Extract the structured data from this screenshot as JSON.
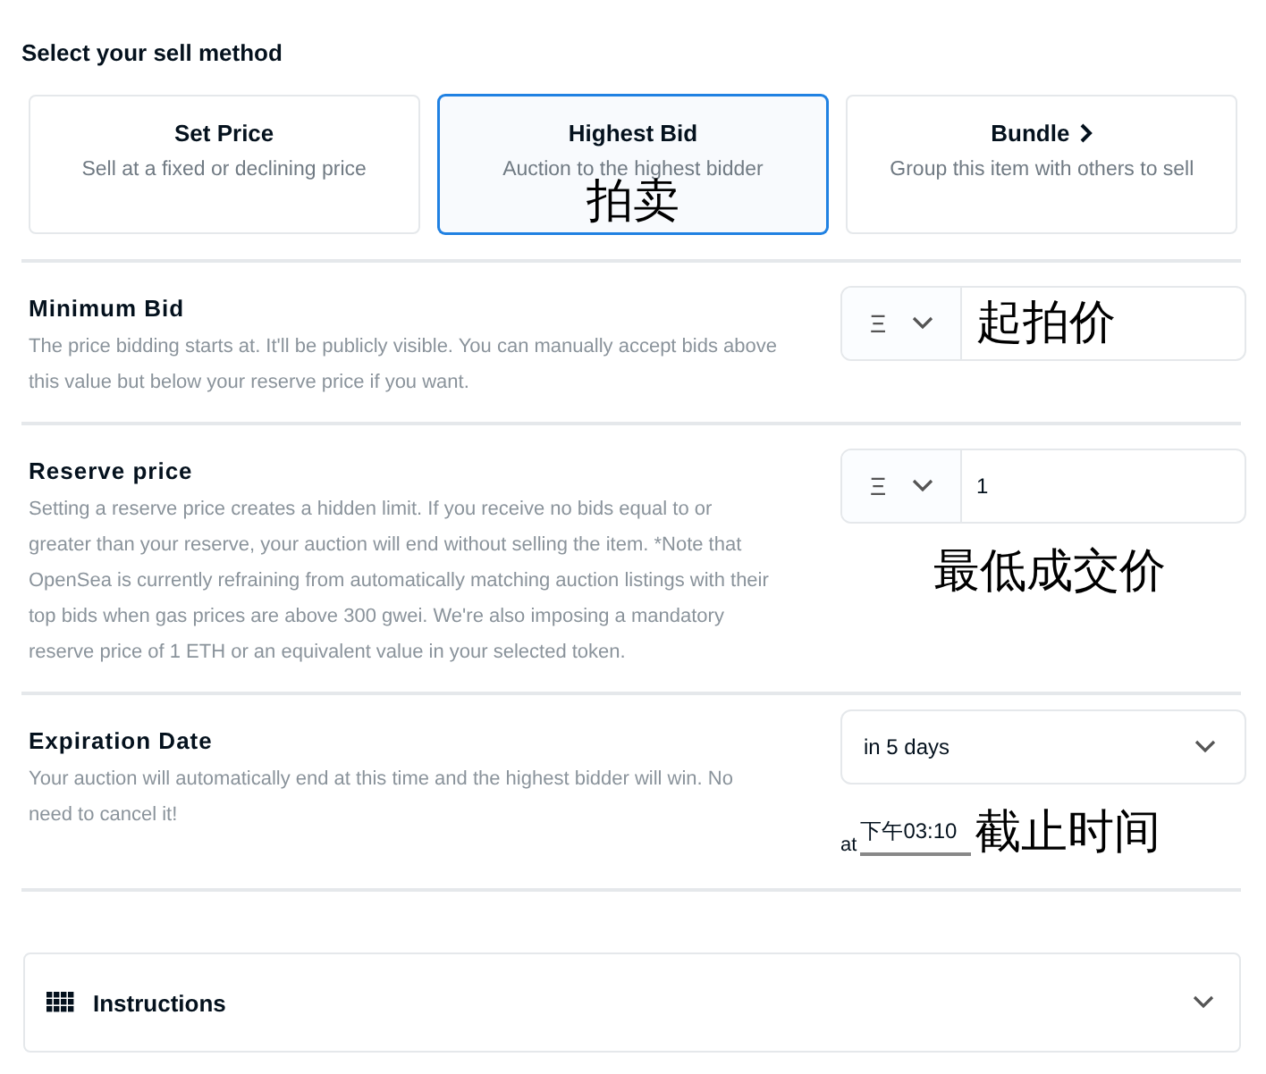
{
  "heading": "Select your sell method",
  "methods": [
    {
      "title": "Set Price",
      "subtitle": "Sell at a fixed or declining price",
      "selected": false,
      "arrow": false
    },
    {
      "title": "Highest Bid",
      "subtitle": "Auction to the highest bidder",
      "selected": true,
      "arrow": false,
      "annotation": "拍卖"
    },
    {
      "title": "Bundle",
      "subtitle": "Group this item with others to sell",
      "selected": false,
      "arrow": true
    }
  ],
  "sections": [
    {
      "kind": "price",
      "title": "Minimum Bid",
      "description": "The price bidding starts at. It'll be publicly visible. You can manually accept bids above this value but below your reserve price if you want.",
      "currency": "Ξ",
      "annotation": "起拍价"
    },
    {
      "kind": "price",
      "title": "Reserve price",
      "description": "Setting a reserve price creates a hidden limit. If you receive no bids equal to or greater than your reserve, your auction will end without selling the item. *Note that OpenSea is currently refraining from automatically matching auction listings with their top bids when gas prices are above 300 gwei. We're also imposing a mandatory reserve price of 1 ETH or an equivalent value in your selected token.",
      "currency": "Ξ",
      "value": "1",
      "note": "最低成交价"
    },
    {
      "kind": "select",
      "title": "Expiration Date",
      "description": "Your auction will automatically end at this time and the highest bidder will win. No need to cancel it!",
      "value": "in 5 days",
      "time_prefix": "at",
      "time": "下午03:10",
      "note": "截止时间"
    }
  ],
  "instructions": {
    "label": "Instructions",
    "expanded": false
  }
}
